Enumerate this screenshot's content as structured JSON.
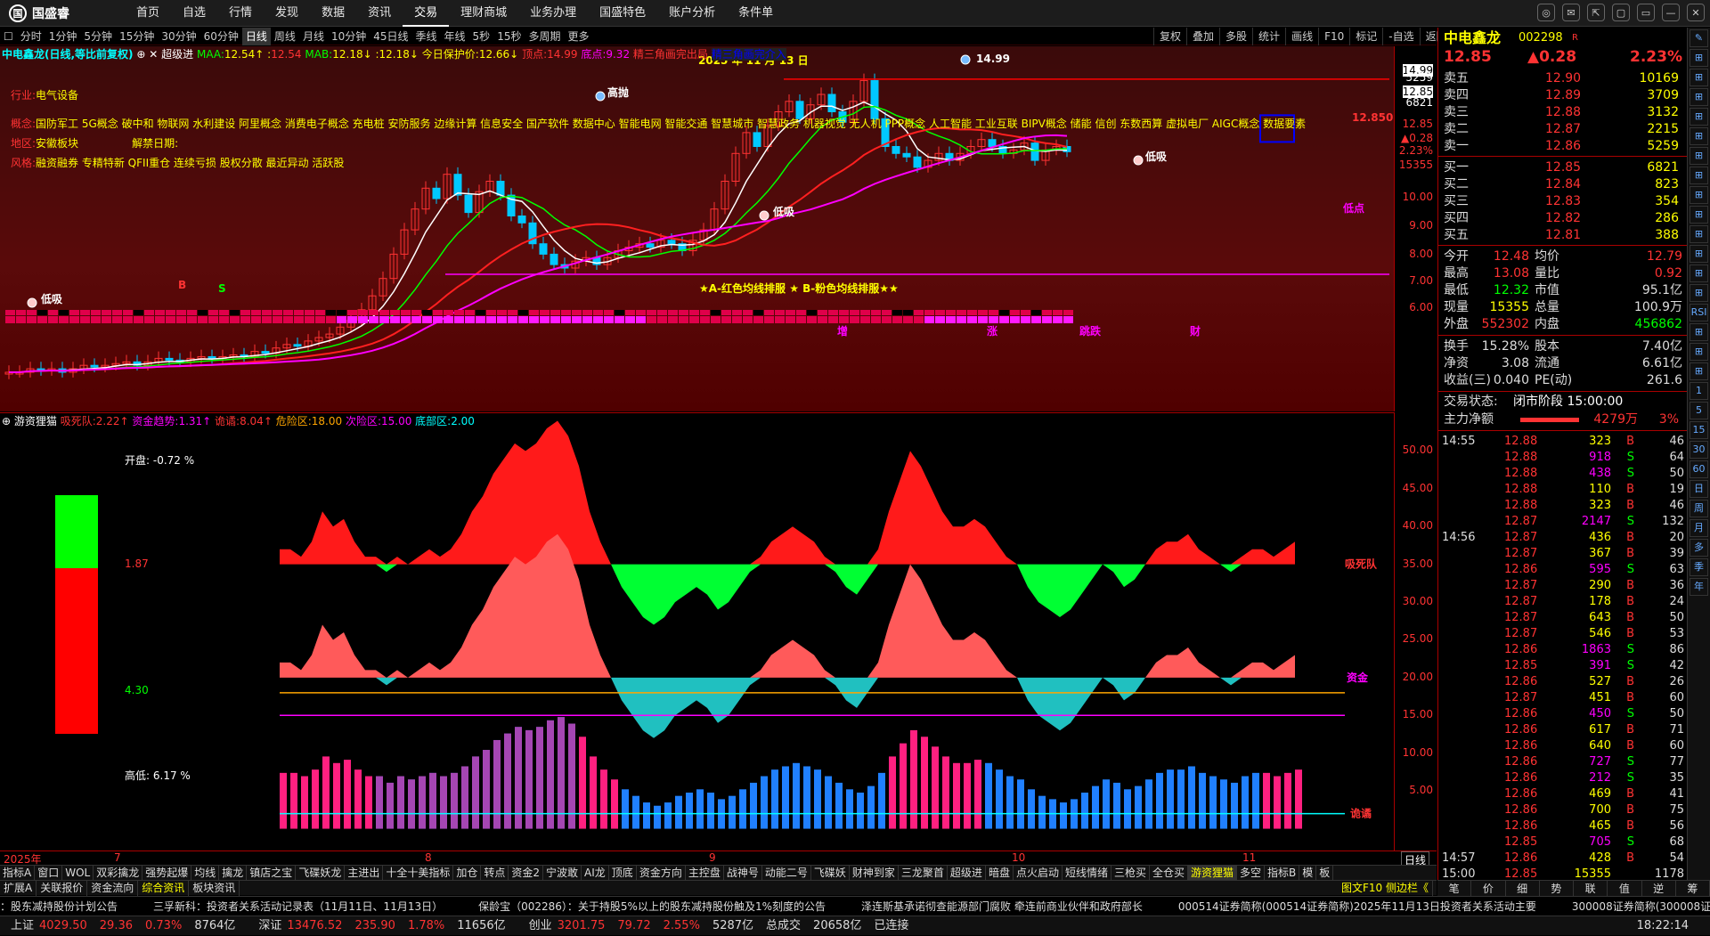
{
  "app": {
    "logo": "国盛睿",
    "logo_mark": "国"
  },
  "nav": [
    "首页",
    "自选",
    "行情",
    "发现",
    "数据",
    "资讯",
    "交易",
    "理财商城",
    "业务办理",
    "国盛特色",
    "账户分析",
    "条件单"
  ],
  "window_buttons": [
    "◎",
    "✉",
    "⇱",
    "▢",
    "▭",
    "—",
    "✕"
  ],
  "periods": [
    "分时",
    "1分钟",
    "5分钟",
    "15分钟",
    "30分钟",
    "60分钟",
    "日线",
    "周线",
    "月线",
    "10分钟",
    "45日线",
    "季线",
    "年线",
    "5秒",
    "15秒",
    "多周期",
    "更多"
  ],
  "active_period": "日线",
  "chart_tools": [
    "复权",
    "叠加",
    "多股",
    "统计",
    "画线",
    "F10",
    "标记",
    "-自选",
    "返回"
  ],
  "kline_header": {
    "name": "中电鑫龙(日线,等比前复权)",
    "ind": "超级进",
    "maa_label": "MAA:",
    "maa": "12.54↑",
    "maa2": "12.54",
    "mab_label": "MAB:",
    "mab": "12.18↓",
    "mab2": "12.18↓",
    "protect_label": "今日保护价:",
    "protect": "12.66↓",
    "dingdian_label": "顶点:",
    "dingdian": "14.99",
    "didian_label": "底点:",
    "didian": "9.32",
    "tri_label": "精三角画完出局",
    "tri2": "精三角画完介入",
    "close_icons": "⊕ ✕"
  },
  "concept": {
    "industry_label": "行业:",
    "industry": "电气设备",
    "concept_label": "概念:",
    "concepts": "国防军工 5G概念 破中和 物联网 水利建设 阿里概念 消费电子概念 充电桩 安防服务 边缘计算 信息安全 国产软件 数据中心 智能电网 智能交通 智慧城市 智慧政务 机器视觉 无人机 PPP概念 人工智能 工业互联 BIPV概念 储能 信创 东数西算 虚拟电厂 AIGC概念 数据要素",
    "region_label": "地区:",
    "region": "安徽板块",
    "unlock_label": "解禁日期:",
    "style_label": "风格:",
    "styles": "融资融券 专精特新 QFII重仓 连续亏损 股权分散 最近异动 活跃股"
  },
  "chart_labels": {
    "date_label": "2025 年 11 月 13 日",
    "high_flag": "14.99",
    "gaopao": "高抛",
    "dixi": "低吸",
    "didian": "低点",
    "price_tag": "12.850",
    "ma_legend": "★A-红色均线排服 ★ B-粉色均线排服★★",
    "b_mark": "B",
    "s_mark": "S",
    "tags": [
      "增",
      "涨",
      "跳跌",
      "财"
    ]
  },
  "kline_axis": [
    "14.99",
    "5259",
    "12.85",
    "6821",
    "12.85",
    "▲0.28",
    "2.23%",
    "15355",
    "10.00",
    "9.00",
    "8.00",
    "7.00",
    "6.00"
  ],
  "sub_header": {
    "name": "游资狸猫",
    "l1": "吸死队:",
    "v1": "2.22↑",
    "l2": "资金趋势:",
    "v2": "1.31↑",
    "l3": "诡谲:",
    "v3": "8.04↑",
    "l4": "危险区:",
    "v4": "18.00",
    "l5": "次险区:",
    "v5": "15.00",
    "l6": "底部区:",
    "v6": "2.00"
  },
  "sub_left": {
    "kaipan_label": "开盘:",
    "kaipan": "-0.72 %",
    "val1": "1.87",
    "val2": "4.30",
    "gaodi_label": "高低:",
    "gaodi": "6.17 %"
  },
  "sub_labels": {
    "xisi": "吸死队",
    "zijin": "资金",
    "zhuli": "诡谲"
  },
  "sub_axis": [
    "50.00",
    "45.00",
    "40.00",
    "35.00",
    "30.00",
    "25.00",
    "20.00",
    "15.00",
    "10.00",
    "5.00"
  ],
  "xaxis": [
    "2025年",
    "7",
    "8",
    "9",
    "10",
    "11",
    "日线"
  ],
  "indicators": [
    "指标A",
    "窗口",
    "WOL",
    "双彩擒龙",
    "强势起爆",
    "均线",
    "擒龙",
    "镇店之宝",
    "飞碟妖龙",
    "主进出",
    "十全十美指标",
    "加仓",
    "转点",
    "资金2",
    "宁波敢",
    "AI龙",
    "顶底",
    "资金方向",
    "主控盘",
    "战神号",
    "动能二号",
    "飞碟妖",
    "财神到家",
    "三龙聚首",
    "超级进",
    "暗盘",
    "点火启动",
    "短线情绪",
    "三枪买",
    "全仓买",
    "游资狸猫",
    "多空",
    "指标B",
    "模",
    "板"
  ],
  "active_indicator": "游资狸猫",
  "indicators2": [
    "扩展A",
    "关联报价",
    "资金流向",
    "综合资讯",
    "板块资讯"
  ],
  "indicators2_right": "图文F10  侧边栏《",
  "news": [
    "：股东减持股份计划公告",
    "三孚新科：投资者关系活动记录表（11月11日、11月13日）",
    "保龄宝（002286）：关于持股5%以上的股东减持股份触及1%刻度的公告",
    "泽连斯基承诺彻查能源部门腐败 牵连前商业伙伴和政府部长",
    "000514证券简称(000514证券简称)2025年11月13日投资者关系活动主要",
    "300008证券简称(300008证券简称)"
  ],
  "status": [
    {
      "name": "上证",
      "price": "4029.50",
      "chg": "29.36",
      "pct": "0.73%",
      "amt": "8764亿"
    },
    {
      "name": "深证",
      "price": "13476.52",
      "chg": "235.90",
      "pct": "1.78%",
      "amt": "11656亿"
    },
    {
      "name": "创业",
      "price": "3201.75",
      "chg": "79.72",
      "pct": "2.55%",
      "amt": "5287亿"
    }
  ],
  "status_total_label": "总成交",
  "status_total": "20658亿",
  "connected": "已连接",
  "time": "18:22:14",
  "quote": {
    "name": "中电鑫龙",
    "code": "002298",
    "r": "R",
    "price": "12.85",
    "chg": "▲0.28",
    "pct": "2.23%",
    "asks": [
      {
        "l": "卖五",
        "p": "12.90",
        "v": "10169"
      },
      {
        "l": "卖四",
        "p": "12.89",
        "v": "3709"
      },
      {
        "l": "卖三",
        "p": "12.88",
        "v": "3132"
      },
      {
        "l": "卖二",
        "p": "12.87",
        "v": "2215"
      },
      {
        "l": "卖一",
        "p": "12.86",
        "v": "5259"
      }
    ],
    "bids": [
      {
        "l": "买一",
        "p": "12.85",
        "v": "6821"
      },
      {
        "l": "买二",
        "p": "12.84",
        "v": "823"
      },
      {
        "l": "买三",
        "p": "12.83",
        "v": "354"
      },
      {
        "l": "买四",
        "p": "12.82",
        "v": "286"
      },
      {
        "l": "买五",
        "p": "12.81",
        "v": "388"
      }
    ],
    "stats": [
      {
        "l1": "今开",
        "v1": "12.48",
        "l2": "均价",
        "v2": "12.79"
      },
      {
        "l1": "最高",
        "v1": "13.08",
        "l2": "量比",
        "v2": "0.92"
      },
      {
        "l1": "最低",
        "v1": "12.32",
        "l2": "市值",
        "v2": "95.1亿"
      },
      {
        "l1": "现量",
        "v1": "15355",
        "l2": "总量",
        "v2": "100.9万"
      },
      {
        "l1": "外盘",
        "v1": "552302",
        "l2": "内盘",
        "v2": "456862"
      }
    ],
    "stats2": [
      {
        "l1": "换手",
        "v1": "15.28%",
        "l2": "股本",
        "v2": "7.40亿"
      },
      {
        "l1": "净资",
        "v1": "3.08",
        "l2": "流通",
        "v2": "6.61亿"
      },
      {
        "l1": "收益(三)",
        "v1": "0.040",
        "l2": "PE(动)",
        "v2": "261.6"
      }
    ],
    "trade_state_label": "交易状态:",
    "trade_state": "闭市阶段 15:00:00",
    "mainflow_label": "主力净额",
    "mainflow": "4279万",
    "mainflow_pct": "3%"
  },
  "ticks": [
    {
      "t": "14:55",
      "p": "12.88",
      "v": "323",
      "d": "B",
      "n": "46"
    },
    {
      "t": "",
      "p": "12.88",
      "v": "918",
      "d": "S",
      "n": "64"
    },
    {
      "t": "",
      "p": "12.88",
      "v": "438",
      "d": "S",
      "n": "50"
    },
    {
      "t": "",
      "p": "12.88",
      "v": "110",
      "d": "B",
      "n": "19"
    },
    {
      "t": "",
      "p": "12.88",
      "v": "323",
      "d": "B",
      "n": "46"
    },
    {
      "t": "",
      "p": "12.87",
      "v": "2147",
      "d": "S",
      "n": "132"
    },
    {
      "t": "14:56",
      "p": "12.87",
      "v": "436",
      "d": "B",
      "n": "20"
    },
    {
      "t": "",
      "p": "12.87",
      "v": "367",
      "d": "B",
      "n": "39"
    },
    {
      "t": "",
      "p": "12.86",
      "v": "595",
      "d": "S",
      "n": "63"
    },
    {
      "t": "",
      "p": "12.87",
      "v": "290",
      "d": "B",
      "n": "36"
    },
    {
      "t": "",
      "p": "12.87",
      "v": "178",
      "d": "B",
      "n": "24"
    },
    {
      "t": "",
      "p": "12.87",
      "v": "643",
      "d": "B",
      "n": "50"
    },
    {
      "t": "",
      "p": "12.87",
      "v": "546",
      "d": "B",
      "n": "53"
    },
    {
      "t": "",
      "p": "12.86",
      "v": "1863",
      "d": "S",
      "n": "86"
    },
    {
      "t": "",
      "p": "12.85",
      "v": "391",
      "d": "S",
      "n": "42"
    },
    {
      "t": "",
      "p": "12.86",
      "v": "527",
      "d": "B",
      "n": "26"
    },
    {
      "t": "",
      "p": "12.87",
      "v": "451",
      "d": "B",
      "n": "60"
    },
    {
      "t": "",
      "p": "12.86",
      "v": "450",
      "d": "S",
      "n": "50"
    },
    {
      "t": "",
      "p": "12.86",
      "v": "617",
      "d": "B",
      "n": "71"
    },
    {
      "t": "",
      "p": "12.86",
      "v": "640",
      "d": "B",
      "n": "60"
    },
    {
      "t": "",
      "p": "12.86",
      "v": "727",
      "d": "S",
      "n": "77"
    },
    {
      "t": "",
      "p": "12.86",
      "v": "212",
      "d": "S",
      "n": "35"
    },
    {
      "t": "",
      "p": "12.86",
      "v": "469",
      "d": "B",
      "n": "41"
    },
    {
      "t": "",
      "p": "12.86",
      "v": "700",
      "d": "B",
      "n": "75"
    },
    {
      "t": "",
      "p": "12.86",
      "v": "465",
      "d": "B",
      "n": "56"
    },
    {
      "t": "",
      "p": "12.85",
      "v": "705",
      "d": "S",
      "n": "68"
    },
    {
      "t": "14:57",
      "p": "12.86",
      "v": "428",
      "d": "B",
      "n": "54"
    },
    {
      "t": "15:00",
      "p": "12.85",
      "v": "15355",
      "d": "",
      "n": "1178"
    }
  ],
  "rbottom": [
    "笔",
    "价",
    "细",
    "势",
    "联",
    "值",
    "逆",
    "筹"
  ],
  "rside": [
    "✎",
    "⊞",
    "⊞",
    "⊞",
    "⊞",
    "⊞",
    "⊞",
    "⊞",
    "⊞",
    "⊞",
    "⊞",
    "⊞",
    "⊞",
    "⊞",
    "RSI",
    "⊞",
    "⊞",
    "⊞",
    "1",
    "5",
    "15",
    "30",
    "60",
    "日",
    "周",
    "月",
    "多",
    "季",
    "年"
  ],
  "colors": {
    "up": "#ff3333",
    "down": "#00c8ff",
    "ma1": "#ffffff",
    "ma2": "#ff00ff",
    "ma3": "#00ff00",
    "bg": "#000000"
  }
}
